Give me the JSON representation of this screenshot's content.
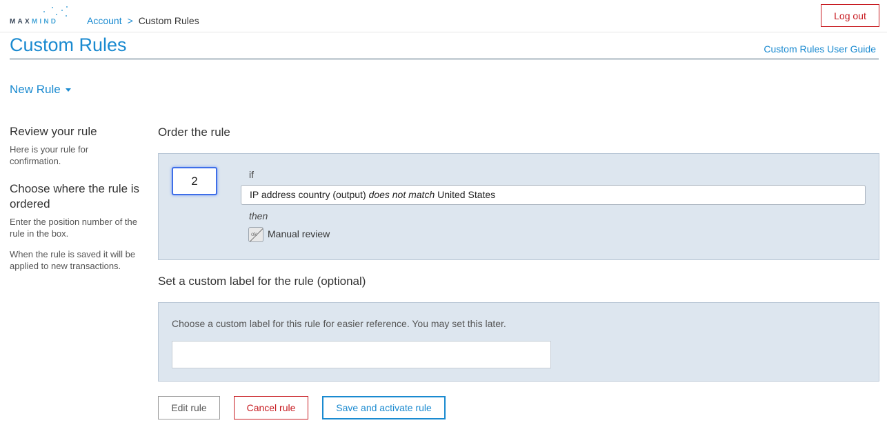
{
  "logo": {
    "text_a": "MAX",
    "text_b": "MIND"
  },
  "breadcrumb": {
    "account": "Account",
    "separator": ">",
    "current": "Custom Rules"
  },
  "header": {
    "logout_label": "Log out",
    "title": "Custom Rules",
    "guide_link": "Custom Rules User Guide"
  },
  "new_rule": {
    "label": "New Rule"
  },
  "sidebar": {
    "review_title": "Review your rule",
    "review_text": "Here is your rule for confirmation.",
    "order_title": "Choose where the rule is ordered",
    "order_text": "Enter the position number of the rule in the box.",
    "saved_text": "When the rule is saved it will be applied to new transactions."
  },
  "order_section": {
    "title": "Order the rule",
    "position_value": "2",
    "if_label": "if",
    "condition": {
      "field": "IP address country (output)",
      "operator": "does not match",
      "value": "United States"
    },
    "then_label": "then",
    "action_icon_text": "ok",
    "action_label": "Manual review"
  },
  "label_section": {
    "title": "Set a custom label for the rule (optional)",
    "description": "Choose a custom label for this rule for easier reference. You may set this later.",
    "input_value": "",
    "input_placeholder": ""
  },
  "buttons": {
    "edit": "Edit rule",
    "cancel": "Cancel rule",
    "save": "Save and activate rule"
  },
  "colors": {
    "brand_blue": "#1a8ad0",
    "danger_red": "#c7191f",
    "panel_bg": "#dde6ef",
    "focus_blue": "#3e6ee8"
  },
  "icons": {
    "caret": "chevron-down-icon",
    "action": "manual-review-icon"
  }
}
